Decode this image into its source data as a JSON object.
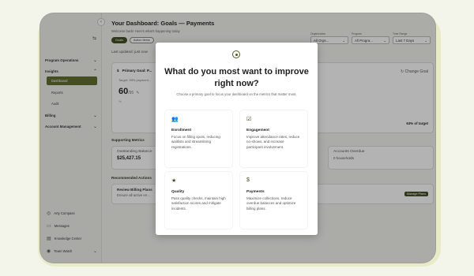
{
  "header": {
    "title": "Your Dashboard: Goals — Payments",
    "welcome": "Welcome back! Here's what's happening today",
    "chips": [
      "Goals",
      "Action Items",
      ""
    ],
    "last_updated": "Last updated: just now"
  },
  "filters": [
    {
      "label": "Organization",
      "value": "All Orgs..."
    },
    {
      "label": "Program",
      "value": "All Progra..."
    },
    {
      "label": "Time Range",
      "value": "Last 7 Days"
    }
  ],
  "sidebar": {
    "sections": [
      {
        "label": "Program Operations"
      },
      {
        "label": "Insights"
      },
      {
        "label": "Billing"
      },
      {
        "label": "Account Management"
      }
    ],
    "items": [
      {
        "label": "Dashboard"
      },
      {
        "label": "Reports"
      },
      {
        "label": "Audit"
      }
    ],
    "bottom": [
      {
        "label": "Arty Compass",
        "icon": "compass-icon"
      },
      {
        "label": "Messages",
        "icon": "message-icon"
      },
      {
        "label": "Knowledge Center",
        "icon": "book-icon"
      },
      {
        "label": "Team Watch",
        "icon": "eye-icon"
      }
    ]
  },
  "goal_card": {
    "title": "Primary Goal: P...",
    "target": "Target: 95% payment...",
    "score": "60",
    "score_max": "/95",
    "pct": "%",
    "change_goal": "Change Goal",
    "target_pct": "63% of target"
  },
  "supporting": {
    "label": "Supporting Metrics",
    "cards": [
      {
        "title": "Outstanding Balance",
        "value": "$25,427.15"
      },
      {
        "title": "Accounts Overdue",
        "value": "0 households"
      }
    ]
  },
  "actions": {
    "label": "Recommended Actions",
    "item": {
      "title": "Review Billing Plans",
      "desc": "Ensure all active en...",
      "button": "Manage Plans"
    }
  },
  "modal": {
    "title": "What do you most want to improve right now?",
    "subtitle": "Choose a primary goal to focus your dashboard on the metrics that matter most.",
    "options": [
      {
        "title": "Enrollment",
        "icon": "people-icon",
        "desc": "Focus on filling spots, reducing waitlists and streamlining registrations."
      },
      {
        "title": "Engagement",
        "icon": "checkbox-icon",
        "desc": "Improve attendance rates, reduce no-shows, and increase participant involvement."
      },
      {
        "title": "Quality",
        "icon": "star-icon",
        "desc": "Pass quality checks, maintain high satisfaction scores and mitigate incidents."
      },
      {
        "title": "Payments",
        "icon": "dollar-icon",
        "desc": "Maximize collections, reduce overdue balances and optimize billing plans."
      }
    ]
  },
  "colors": {
    "accent": "#5b6b2b",
    "accent_dark": "#3f4a20",
    "frame": "#e7ebc8"
  }
}
